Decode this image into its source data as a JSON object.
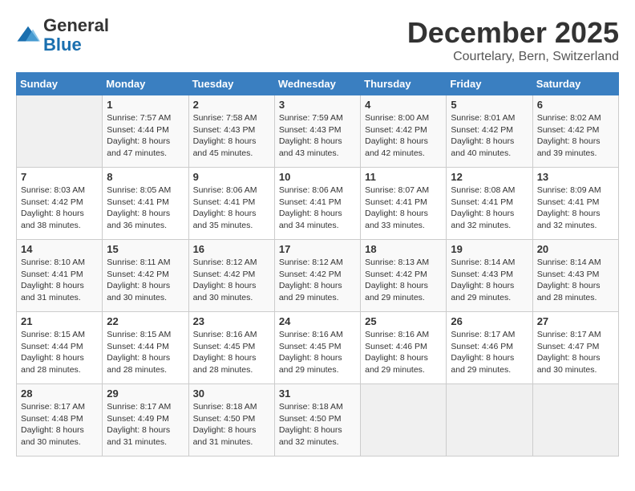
{
  "header": {
    "logo": {
      "general": "General",
      "blue": "Blue"
    },
    "month": "December 2025",
    "location": "Courtelary, Bern, Switzerland"
  },
  "weekdays": [
    "Sunday",
    "Monday",
    "Tuesday",
    "Wednesday",
    "Thursday",
    "Friday",
    "Saturday"
  ],
  "weeks": [
    [
      {
        "day": null
      },
      {
        "day": 1,
        "sunrise": "7:57 AM",
        "sunset": "4:44 PM",
        "daylight": "8 hours and 47 minutes."
      },
      {
        "day": 2,
        "sunrise": "7:58 AM",
        "sunset": "4:43 PM",
        "daylight": "8 hours and 45 minutes."
      },
      {
        "day": 3,
        "sunrise": "7:59 AM",
        "sunset": "4:43 PM",
        "daylight": "8 hours and 43 minutes."
      },
      {
        "day": 4,
        "sunrise": "8:00 AM",
        "sunset": "4:42 PM",
        "daylight": "8 hours and 42 minutes."
      },
      {
        "day": 5,
        "sunrise": "8:01 AM",
        "sunset": "4:42 PM",
        "daylight": "8 hours and 40 minutes."
      },
      {
        "day": 6,
        "sunrise": "8:02 AM",
        "sunset": "4:42 PM",
        "daylight": "8 hours and 39 minutes."
      }
    ],
    [
      {
        "day": 7,
        "sunrise": "8:03 AM",
        "sunset": "4:42 PM",
        "daylight": "8 hours and 38 minutes."
      },
      {
        "day": 8,
        "sunrise": "8:05 AM",
        "sunset": "4:41 PM",
        "daylight": "8 hours and 36 minutes."
      },
      {
        "day": 9,
        "sunrise": "8:06 AM",
        "sunset": "4:41 PM",
        "daylight": "8 hours and 35 minutes."
      },
      {
        "day": 10,
        "sunrise": "8:06 AM",
        "sunset": "4:41 PM",
        "daylight": "8 hours and 34 minutes."
      },
      {
        "day": 11,
        "sunrise": "8:07 AM",
        "sunset": "4:41 PM",
        "daylight": "8 hours and 33 minutes."
      },
      {
        "day": 12,
        "sunrise": "8:08 AM",
        "sunset": "4:41 PM",
        "daylight": "8 hours and 32 minutes."
      },
      {
        "day": 13,
        "sunrise": "8:09 AM",
        "sunset": "4:41 PM",
        "daylight": "8 hours and 32 minutes."
      }
    ],
    [
      {
        "day": 14,
        "sunrise": "8:10 AM",
        "sunset": "4:41 PM",
        "daylight": "8 hours and 31 minutes."
      },
      {
        "day": 15,
        "sunrise": "8:11 AM",
        "sunset": "4:42 PM",
        "daylight": "8 hours and 30 minutes."
      },
      {
        "day": 16,
        "sunrise": "8:12 AM",
        "sunset": "4:42 PM",
        "daylight": "8 hours and 30 minutes."
      },
      {
        "day": 17,
        "sunrise": "8:12 AM",
        "sunset": "4:42 PM",
        "daylight": "8 hours and 29 minutes."
      },
      {
        "day": 18,
        "sunrise": "8:13 AM",
        "sunset": "4:42 PM",
        "daylight": "8 hours and 29 minutes."
      },
      {
        "day": 19,
        "sunrise": "8:14 AM",
        "sunset": "4:43 PM",
        "daylight": "8 hours and 29 minutes."
      },
      {
        "day": 20,
        "sunrise": "8:14 AM",
        "sunset": "4:43 PM",
        "daylight": "8 hours and 28 minutes."
      }
    ],
    [
      {
        "day": 21,
        "sunrise": "8:15 AM",
        "sunset": "4:44 PM",
        "daylight": "8 hours and 28 minutes."
      },
      {
        "day": 22,
        "sunrise": "8:15 AM",
        "sunset": "4:44 PM",
        "daylight": "8 hours and 28 minutes."
      },
      {
        "day": 23,
        "sunrise": "8:16 AM",
        "sunset": "4:45 PM",
        "daylight": "8 hours and 28 minutes."
      },
      {
        "day": 24,
        "sunrise": "8:16 AM",
        "sunset": "4:45 PM",
        "daylight": "8 hours and 29 minutes."
      },
      {
        "day": 25,
        "sunrise": "8:16 AM",
        "sunset": "4:46 PM",
        "daylight": "8 hours and 29 minutes."
      },
      {
        "day": 26,
        "sunrise": "8:17 AM",
        "sunset": "4:46 PM",
        "daylight": "8 hours and 29 minutes."
      },
      {
        "day": 27,
        "sunrise": "8:17 AM",
        "sunset": "4:47 PM",
        "daylight": "8 hours and 30 minutes."
      }
    ],
    [
      {
        "day": 28,
        "sunrise": "8:17 AM",
        "sunset": "4:48 PM",
        "daylight": "8 hours and 30 minutes."
      },
      {
        "day": 29,
        "sunrise": "8:17 AM",
        "sunset": "4:49 PM",
        "daylight": "8 hours and 31 minutes."
      },
      {
        "day": 30,
        "sunrise": "8:18 AM",
        "sunset": "4:50 PM",
        "daylight": "8 hours and 31 minutes."
      },
      {
        "day": 31,
        "sunrise": "8:18 AM",
        "sunset": "4:50 PM",
        "daylight": "8 hours and 32 minutes."
      },
      {
        "day": null
      },
      {
        "day": null
      },
      {
        "day": null
      }
    ]
  ]
}
